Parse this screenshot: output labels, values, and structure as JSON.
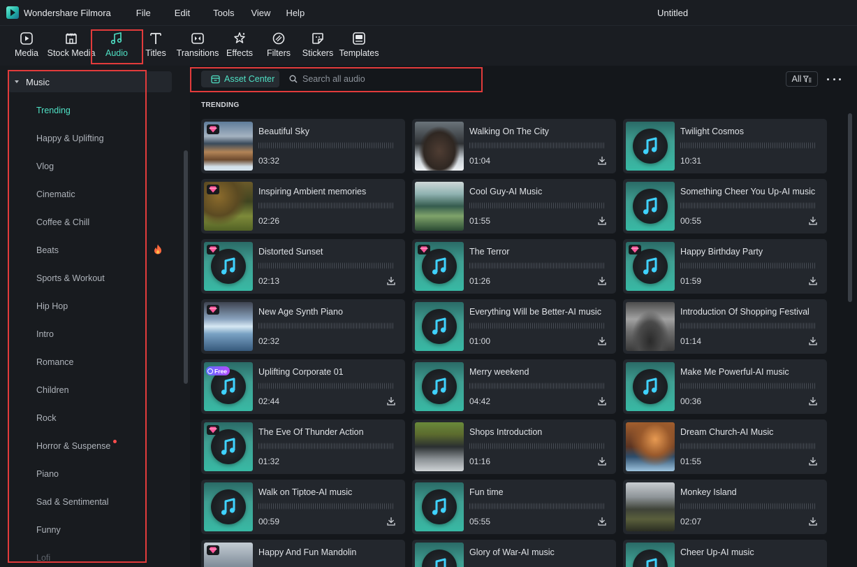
{
  "app": {
    "name": "Wondershare Filmora",
    "document_title": "Untitled"
  },
  "menu": [
    "File",
    "Edit",
    "Tools",
    "View",
    "Help"
  ],
  "toolbar": [
    {
      "label": "Media",
      "icon": "media-icon"
    },
    {
      "label": "Stock Media",
      "icon": "stock-media-icon"
    },
    {
      "label": "Audio",
      "icon": "music-note-icon",
      "active": true
    },
    {
      "label": "Titles",
      "icon": "titles-icon"
    },
    {
      "label": "Transitions",
      "icon": "transitions-icon"
    },
    {
      "label": "Effects",
      "icon": "effects-icon"
    },
    {
      "label": "Filters",
      "icon": "filters-icon"
    },
    {
      "label": "Stickers",
      "icon": "stickers-icon"
    },
    {
      "label": "Templates",
      "icon": "templates-icon"
    }
  ],
  "sidebar": {
    "section": "Music",
    "categories": [
      {
        "label": "Trending",
        "selected": true
      },
      {
        "label": "Happy & Uplifting"
      },
      {
        "label": "Vlog"
      },
      {
        "label": "Cinematic"
      },
      {
        "label": "Coffee & Chill"
      },
      {
        "label": "Beats",
        "marker": "flame-icon"
      },
      {
        "label": "Sports & Workout"
      },
      {
        "label": "Hip Hop"
      },
      {
        "label": "Intro"
      },
      {
        "label": "Romance"
      },
      {
        "label": "Children"
      },
      {
        "label": "Rock"
      },
      {
        "label": "Horror & Suspense",
        "marker": "new-dot"
      },
      {
        "label": "Piano"
      },
      {
        "label": "Sad & Sentimental"
      },
      {
        "label": "Funny"
      },
      {
        "label": "Lofi"
      }
    ]
  },
  "search": {
    "asset_center_label": "Asset Center",
    "placeholder": "Search all audio",
    "value": "",
    "filter_label": "All"
  },
  "section_title": "TRENDING",
  "colors": {
    "accent": "#4fe0c4",
    "highlight_box": "#e23b3b",
    "premium": "#ff5a9e"
  },
  "tracks": [
    {
      "title": "Beautiful Sky",
      "duration": "03:32",
      "badge": "premium",
      "thumb": "sky",
      "download": false
    },
    {
      "title": "Walking On The City",
      "duration": "01:04",
      "badge": null,
      "thumb": "city",
      "download": true
    },
    {
      "title": "Twilight Cosmos",
      "duration": "10:31",
      "badge": null,
      "thumb": "generic",
      "download": false
    },
    {
      "title": "Inspiring Ambient memories",
      "duration": "02:26",
      "badge": "premium",
      "thumb": "ambient",
      "download": false
    },
    {
      "title": "Cool Guy-AI Music",
      "duration": "01:55",
      "badge": null,
      "thumb": "coolguy",
      "download": true
    },
    {
      "title": "Something Cheer You Up-AI music",
      "duration": "00:55",
      "badge": null,
      "thumb": "generic",
      "download": true
    },
    {
      "title": "Distorted Sunset",
      "duration": "02:13",
      "badge": "premium",
      "thumb": "generic",
      "download": true
    },
    {
      "title": "The Terror",
      "duration": "01:26",
      "badge": "premium",
      "thumb": "generic",
      "download": true
    },
    {
      "title": "Happy Birthday Party",
      "duration": "01:59",
      "badge": "premium",
      "thumb": "generic",
      "download": true
    },
    {
      "title": "New Age Synth Piano",
      "duration": "02:32",
      "badge": "premium",
      "thumb": "synth",
      "download": false
    },
    {
      "title": "Everything Will be Better-AI music",
      "duration": "01:00",
      "badge": null,
      "thumb": "generic",
      "download": true
    },
    {
      "title": "Introduction Of Shopping Festival",
      "duration": "01:14",
      "badge": null,
      "thumb": "shopping",
      "download": true
    },
    {
      "title": "Uplifting Corporate 01",
      "duration": "02:44",
      "badge": "free",
      "badge_label": "Free",
      "thumb": "generic",
      "download": true
    },
    {
      "title": "Merry weekend",
      "duration": "04:42",
      "badge": null,
      "thumb": "generic",
      "download": true
    },
    {
      "title": "Make Me Powerful-AI music",
      "duration": "00:36",
      "badge": null,
      "thumb": "generic",
      "download": true
    },
    {
      "title": "The Eve Of Thunder Action",
      "duration": "01:32",
      "badge": "premium",
      "thumb": "generic",
      "download": false
    },
    {
      "title": "Shops Introduction",
      "duration": "01:16",
      "badge": null,
      "thumb": "shops",
      "download": true
    },
    {
      "title": "Dream Church-AI Music",
      "duration": "01:55",
      "badge": null,
      "thumb": "church",
      "download": true
    },
    {
      "title": "Walk on Tiptoe-AI music",
      "duration": "00:59",
      "badge": null,
      "thumb": "generic",
      "download": true
    },
    {
      "title": "Fun time",
      "duration": "05:55",
      "badge": null,
      "thumb": "generic",
      "download": true
    },
    {
      "title": "Monkey Island",
      "duration": "02:07",
      "badge": null,
      "thumb": "monkey",
      "download": true
    },
    {
      "title": "Happy And Fun Mandolin",
      "duration": "",
      "badge": "premium",
      "thumb": "mandolin",
      "download": false
    },
    {
      "title": "Glory of War-AI music",
      "duration": "",
      "badge": null,
      "thumb": "generic",
      "download": false
    },
    {
      "title": "Cheer Up-AI music",
      "duration": "",
      "badge": null,
      "thumb": "generic",
      "download": false
    }
  ]
}
